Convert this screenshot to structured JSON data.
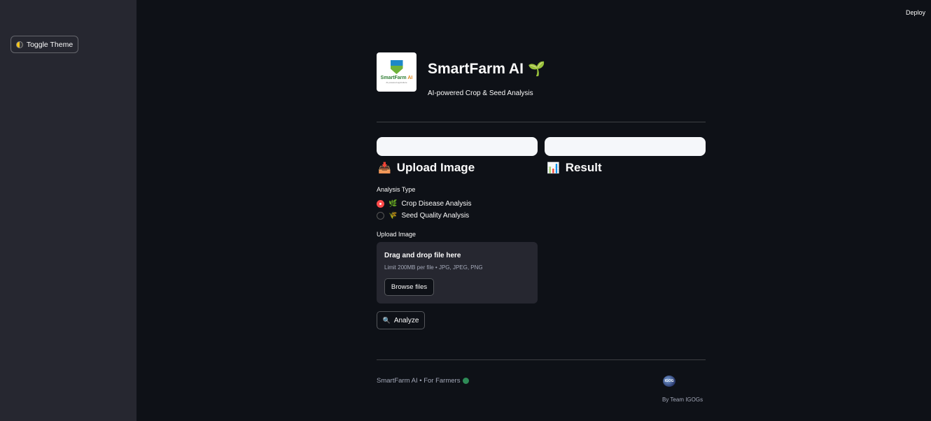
{
  "sidebar": {
    "toggle_theme_label": "Toggle Theme"
  },
  "header": {
    "deploy_label": "Deploy"
  },
  "app": {
    "logo_text_main": "SmartFarm ",
    "logo_text_ai": "AI",
    "logo_subtext": "AI-powered agriculture",
    "title": "SmartFarm AI",
    "title_emoji": "🌱",
    "subtitle": "AI-powered Crop & Seed Analysis"
  },
  "upload_section": {
    "icon": "📥",
    "heading": "Upload Image",
    "analysis_type_label": "Analysis Type",
    "options": [
      {
        "icon": "🌿",
        "label": "Crop Disease Analysis",
        "selected": true
      },
      {
        "icon": "🌾",
        "label": "Seed Quality Analysis",
        "selected": false
      }
    ],
    "upload_label": "Upload Image",
    "dropzone_title": "Drag and drop file here",
    "dropzone_limit": "Limit 200MB per file • JPG, JPEG, PNG",
    "browse_label": "Browse files",
    "analyze_icon": "🔍",
    "analyze_label": "Analyze"
  },
  "result_section": {
    "icon": "📊",
    "heading": "Result"
  },
  "footer": {
    "left_text": "SmartFarm AI • For Farmers",
    "team_logo_text": "IGOG",
    "team_text": "By Team IGOGs"
  },
  "colors": {
    "background": "#0e1117",
    "sidebar": "#262730",
    "accent": "#ff4b4b",
    "text": "#fafafa"
  }
}
